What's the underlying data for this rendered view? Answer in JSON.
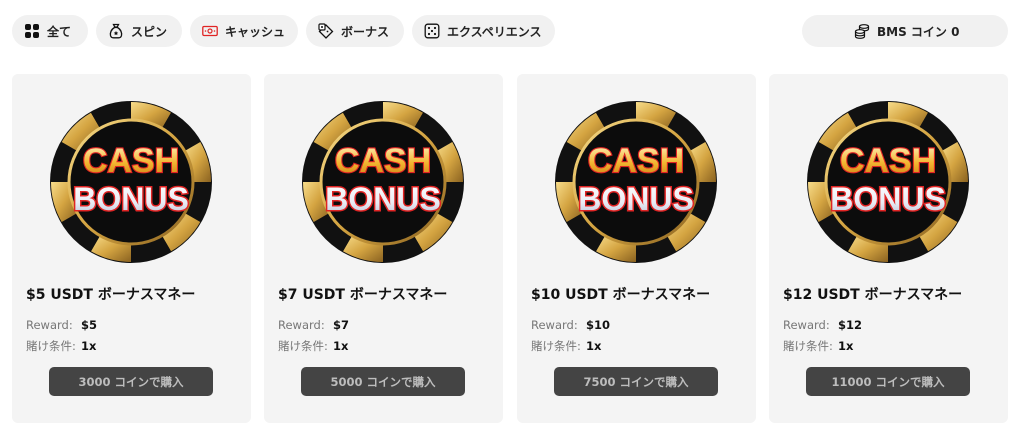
{
  "filters": [
    {
      "label": "全て",
      "icon": "grid-icon"
    },
    {
      "label": "スピン",
      "icon": "money-bag-icon"
    },
    {
      "label": "キャッシュ",
      "icon": "cash-bill-icon"
    },
    {
      "label": "ボーナス",
      "icon": "bonus-tag-icon"
    },
    {
      "label": "エクスペリエンス",
      "icon": "dice-icon"
    }
  ],
  "coin_balance": {
    "label": "BMS コイン 0",
    "icon": "coin-stack-icon"
  },
  "logo_text": {
    "line1": "CASH",
    "line2": "BONUS"
  },
  "colors": {
    "accent_red": "#e02424",
    "gold": "#d4a441",
    "button_bg": "#444444"
  },
  "cards": [
    {
      "title": "$5 USDT ボーナスマネー",
      "reward_label": "Reward:",
      "reward_value": "$5",
      "wager_label": "賭け条件:",
      "wager_value": "1x",
      "button_label": "3000 コインで購入"
    },
    {
      "title": "$7 USDT ボーナスマネー",
      "reward_label": "Reward:",
      "reward_value": "$7",
      "wager_label": "賭け条件:",
      "wager_value": "1x",
      "button_label": "5000 コインで購入"
    },
    {
      "title": "$10 USDT ボーナスマネー",
      "reward_label": "Reward:",
      "reward_value": "$10",
      "wager_label": "賭け条件:",
      "wager_value": "1x",
      "button_label": "7500 コインで購入"
    },
    {
      "title": "$12 USDT ボーナスマネー",
      "reward_label": "Reward:",
      "reward_value": "$12",
      "wager_label": "賭け条件:",
      "wager_value": "1x",
      "button_label": "11000 コインで購入"
    }
  ]
}
